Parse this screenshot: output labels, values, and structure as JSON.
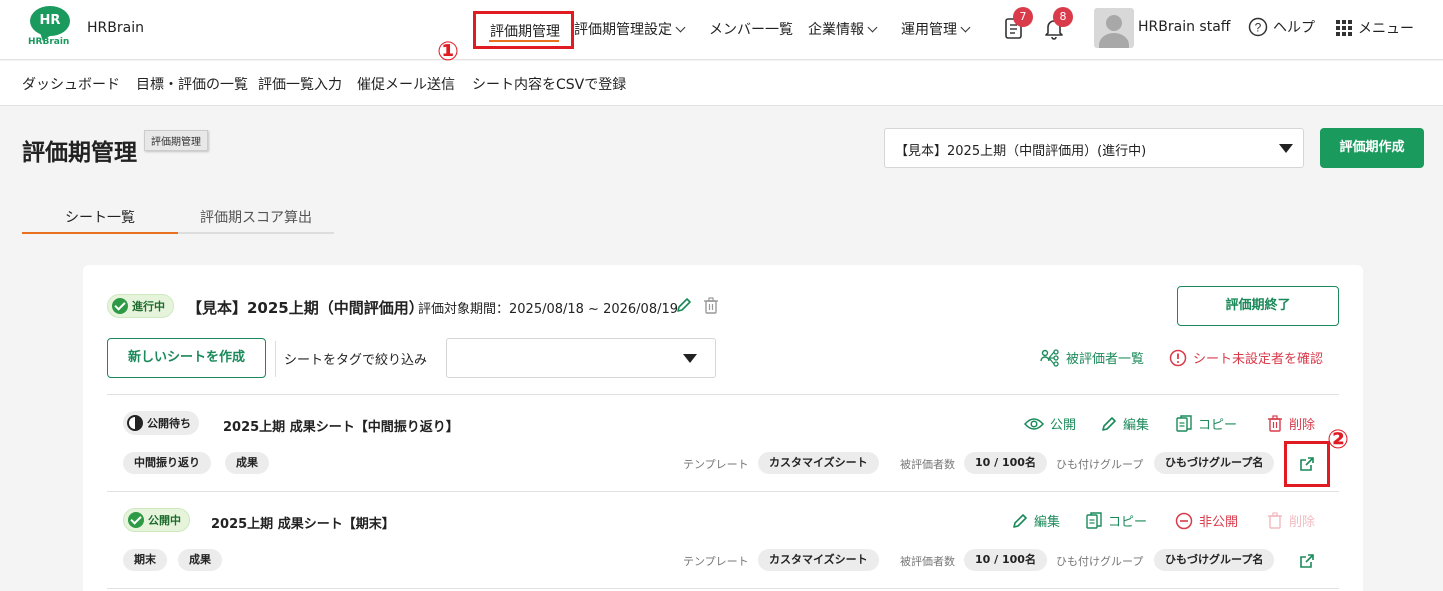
{
  "app": {
    "name": "HRBrain",
    "logo_text": "HR",
    "logo_sub": "HRBrain"
  },
  "topnav": {
    "active": "評価期管理",
    "items": [
      "評価期管理設定",
      "メンバー一覧",
      "企業情報",
      "運用管理"
    ],
    "docs_badge": "7",
    "bell_badge": "8",
    "user_name": "HRBrain staff",
    "help": "ヘルプ",
    "menu": "メニュー"
  },
  "subnav": [
    "ダッシュボード",
    "目標・評価の一覧",
    "評価一覧入力",
    "催促メール送信",
    "シート内容をCSVで登録"
  ],
  "annotations": {
    "one": "①",
    "two": "②"
  },
  "page": {
    "title": "評価期管理",
    "tooltip": "評価期管理",
    "period_selected": "【見本】2025上期（中間評価用）(進行中)",
    "create_button": "評価期作成"
  },
  "tabs": [
    "シート一覧",
    "評価期スコア算出"
  ],
  "period_card": {
    "status": "進行中",
    "title": "【見本】2025上期（中間評価用）",
    "range": "評価対象期間：2025/08/18 ~ 2026/08/19",
    "end_button": "評価期終了",
    "new_sheet_button": "新しいシートを作成",
    "tag_filter_label": "シートをタグで絞り込み",
    "evaluatee_list": "被評価者一覧",
    "check_unset": "シート未設定者を確認"
  },
  "meta_labels": {
    "template": "テンプレート",
    "evaluatee_count": "被評価者数",
    "group": "ひも付けグループ"
  },
  "sheets": [
    {
      "status": "公開待ち",
      "title": "2025上期 成果シート【中間振り返り】",
      "tags": [
        "中間振り返り",
        "成果"
      ],
      "actions": [
        "公開",
        "編集",
        "コピー",
        "削除"
      ],
      "template": "カスタマイズシート",
      "count": "10 / 100名",
      "group": "ひもづけグループ名"
    },
    {
      "status": "公開中",
      "title": "2025上期 成果シート【期末】",
      "tags": [
        "期末",
        "成果"
      ],
      "actions": [
        "編集",
        "コピー",
        "非公開",
        "削除"
      ],
      "template": "カスタマイズシート",
      "count": "10 / 100名",
      "group": "ひもづけグループ名"
    }
  ],
  "colors": {
    "brand": "#1b9a5e",
    "accent": "#e8701e",
    "danger": "#d93b4b",
    "highlight": "#e01b22"
  }
}
